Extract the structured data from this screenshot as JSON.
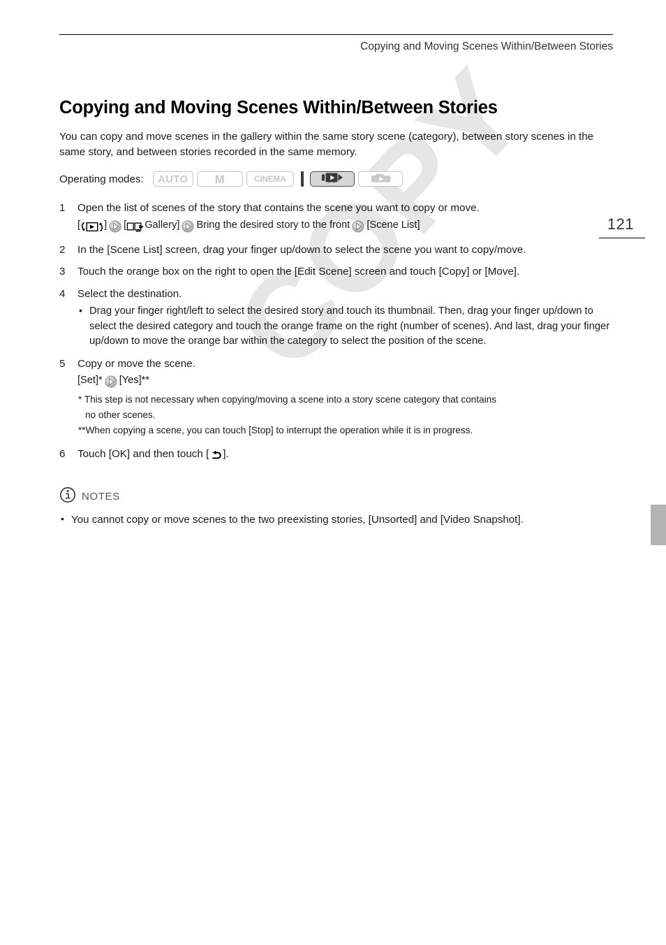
{
  "header": {
    "running_head": "Copying and Moving Scenes Within/Between Stories",
    "page_number": "121"
  },
  "watermark": {
    "text": "COPY"
  },
  "main": {
    "title": "Copying and Moving Scenes Within/Between Stories",
    "intro": "You can copy and move scenes in the gallery within the same story scene (category), between story scenes in the same story, and between stories recorded in the same memory."
  },
  "operating_modes": {
    "label": "Operating modes:",
    "chips": [
      {
        "name": "auto-mode-chip",
        "text": "AUTO",
        "state": "inactive"
      },
      {
        "name": "manual-mode-chip",
        "text": "M",
        "state": "inactive"
      },
      {
        "name": "cinema-mode-chip",
        "text": "CINEMA",
        "state": "inactive"
      },
      {
        "name": "video-playback-mode-chip",
        "icon": "camcorder-playback-icon",
        "state": "active"
      },
      {
        "name": "photo-playback-mode-chip",
        "icon": "photo-playback-icon",
        "state": "inactive"
      }
    ]
  },
  "steps": [
    {
      "num": "1",
      "text": "Open the list of scenes of the story that contains the scene you want to copy or move.",
      "path_prefix": "[",
      "path_after_mode": "]",
      "path_gallery_open": "[",
      "path_gallery_label": "Gallery]",
      "path_bring": "Bring the desired story to the front",
      "path_scene_list": "[Scene List]"
    },
    {
      "num": "2",
      "text": "In the [Scene List] screen, drag your finger up/down to select the scene you want to copy/move."
    },
    {
      "num": "3",
      "text": "Touch the orange box on the right to open the [Edit Scene] screen and touch [Copy] or [Move]."
    },
    {
      "num": "4",
      "text": "Select the destination.",
      "bullets": [
        "Drag your finger right/left to select the desired story and touch its thumbnail. Then, drag your finger up/down to select the desired category and touch the orange frame on the right (number of scenes). And last, drag your finger up/down to move the orange bar within the category to select the position of the scene."
      ]
    },
    {
      "num": "5",
      "text": "Copy or move the scene.",
      "sub_set": "[Set]*",
      "sub_yes": "[Yes]**",
      "footnotes": [
        "*  This step is not necessary when copying/moving a scene into a story scene category that contains",
        "no other scenes.",
        "**When copying a scene, you can touch [Stop] to interrupt the operation while it is in progress."
      ]
    },
    {
      "num": "6",
      "text_before_icon": "Touch [OK] and then touch [",
      "text_after_icon": "]."
    }
  ],
  "notes": {
    "label": "NOTES",
    "icon": "info-icon",
    "items": [
      "You cannot copy or move scenes to the two preexisting stories, [Unsorted] and [Video Snapshot]."
    ]
  },
  "colors": {
    "text": "#1a1a1a",
    "muted": "#555555",
    "chip_inactive": "#c9c9c9",
    "chip_active_bg": "#d6d6d6",
    "watermark": "#e6e6e6",
    "margin_tab": "#b3b3b3"
  }
}
